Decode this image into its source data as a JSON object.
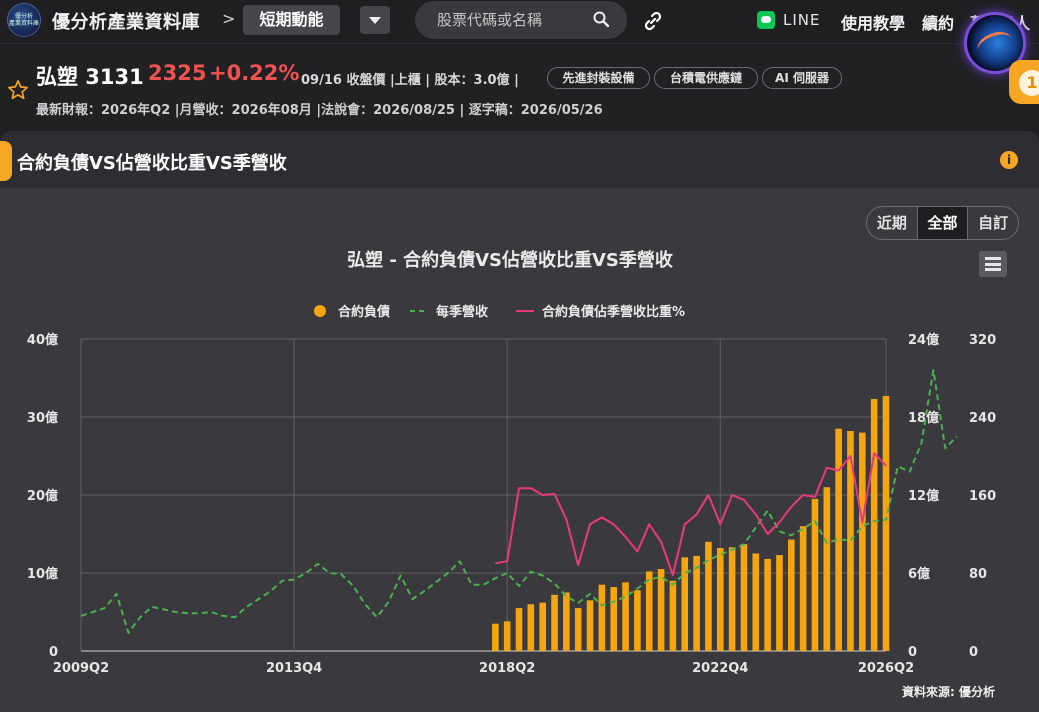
{
  "header": {
    "brand": "優分析產業資料庫",
    "crumb_sep": ">",
    "crumb": "短期動能",
    "logo_text": "優分析\n產業資料庫",
    "search_placeholder": "股票代碼或名稱",
    "line_label": "LINE",
    "nav": [
      "使用教學",
      "續約",
      "葛..達人"
    ],
    "notif_count": "1"
  },
  "stock": {
    "name_code": "弘塑 3131",
    "price": "2325",
    "change": "+0.22%",
    "meta": "09/16 收盤價 |上櫃 | 股本：3.0億 |",
    "tags": [
      "先進封裝設備",
      "台積電供應鏈",
      "AI 伺服器"
    ],
    "meta2": "最新財報：2026年Q2 |月營收：2026年08月 |法說會：2026/08/25 | 逐字稿：2026/05/26"
  },
  "card": {
    "title": "合約負債VS佔營收比重VS季營收",
    "range_buttons": [
      "近期",
      "全部",
      "自訂"
    ],
    "active_range": "全部",
    "source": "資料來源: 優分析"
  },
  "chart_data": {
    "type": "bar+line",
    "title": "弘塑 - 合約負債VS佔營收比重VS季營收",
    "legend_position": "top-center",
    "grid": true,
    "x_tick_labels": [
      "2009Q2",
      "2013Q4",
      "2018Q2",
      "2022Q4",
      "2026Q2"
    ],
    "quarters_start": "2009Q2",
    "quarters_end": "2026Q2",
    "axes": {
      "left": {
        "ticks": [
          "0",
          "10億",
          "20億",
          "30億",
          "40億"
        ],
        "min": 0,
        "max": 40,
        "unit": "億"
      },
      "right1": {
        "ticks": [
          "0",
          "6億",
          "12億",
          "18億",
          "24億"
        ],
        "min": 0,
        "max": 24,
        "unit": "億"
      },
      "right2": {
        "ticks": [
          "0",
          "80",
          "160",
          "240",
          "320"
        ],
        "min": 0,
        "max": 320,
        "unit": "%"
      }
    },
    "series": [
      {
        "name": "合約負債",
        "type": "bar",
        "axis": "left",
        "color": "#f5a60f",
        "start": "2018Q1",
        "values": [
          3.5,
          3.8,
          5.5,
          6.0,
          6.2,
          7.2,
          7.5,
          5.5,
          6.5,
          8.5,
          8.2,
          8.8,
          7.8,
          10.2,
          10.5,
          9.0,
          12.0,
          12.2,
          14.0,
          13.2,
          13.3,
          13.7,
          12.5,
          11.8,
          12.3,
          14.3,
          16.0,
          19.5,
          21.0,
          28.5,
          28.2,
          28.0,
          32.3,
          32.7
        ]
      },
      {
        "name": "每季營收",
        "type": "line",
        "dash": true,
        "axis": "right1",
        "color": "#4caf50",
        "start": "2009Q2",
        "values": [
          2.7,
          3.0,
          3.3,
          4.4,
          1.4,
          2.6,
          3.4,
          3.2,
          3.0,
          2.9,
          2.9,
          3.0,
          2.7,
          2.6,
          3.4,
          4.0,
          4.6,
          5.4,
          5.5,
          6.0,
          6.7,
          6.0,
          5.9,
          5.0,
          3.6,
          2.6,
          3.8,
          5.8,
          4.0,
          4.6,
          5.3,
          6.0,
          6.9,
          5.1,
          5.1,
          5.6,
          6.0,
          5.0,
          6.1,
          5.8,
          5.2,
          4.2,
          3.7,
          4.4,
          3.5,
          3.8,
          4.2,
          4.8,
          5.5,
          5.7,
          5.1,
          6.0,
          6.4,
          7.0,
          7.4,
          7.8,
          8.2,
          9.5,
          10.8,
          9.2,
          8.9,
          9.4,
          10.0,
          8.3,
          8.6,
          8.5,
          9.6,
          10.0,
          10.1,
          14.2,
          13.8,
          16.0,
          21.6,
          15.6,
          16.5
        ]
      },
      {
        "name": "合約負債佔季營收比重%",
        "type": "line",
        "axis": "right2",
        "color": "#e83a78",
        "start": "2018Q1",
        "values": [
          90,
          92,
          167,
          167,
          160,
          161,
          135,
          88,
          130,
          137,
          130,
          117,
          102,
          130,
          112,
          78,
          130,
          140,
          160,
          130,
          160,
          155,
          140,
          120,
          132,
          148,
          160,
          158,
          188,
          185,
          200,
          132,
          203,
          190
        ]
      }
    ]
  }
}
